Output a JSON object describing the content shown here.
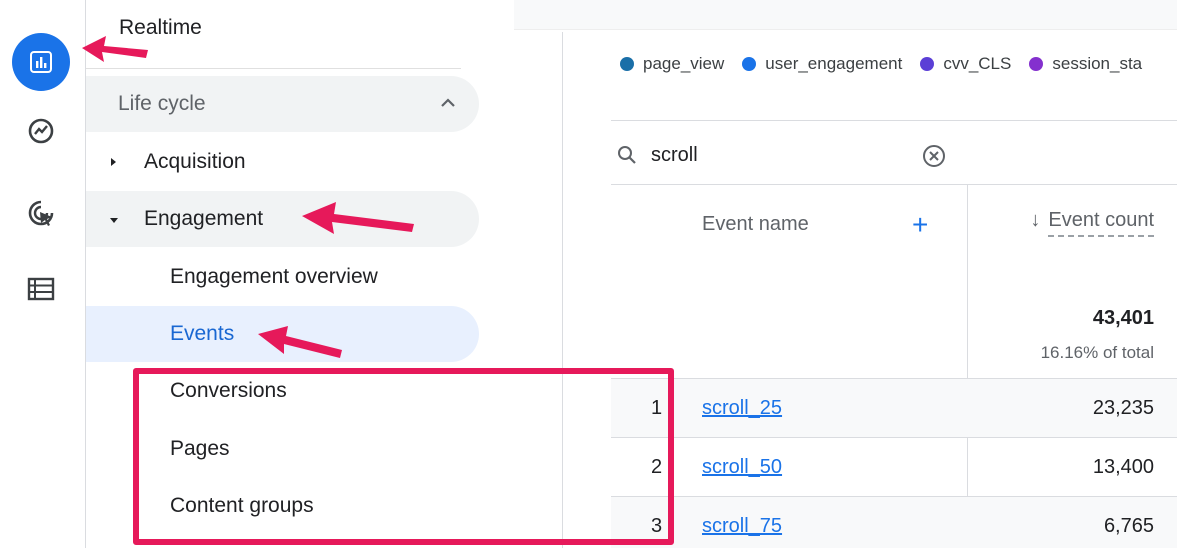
{
  "rail": {
    "icons": [
      "reports-icon",
      "explore-icon",
      "advertising-icon",
      "configure-icon"
    ]
  },
  "nav": {
    "realtime": "Realtime",
    "lifecycle": "Life cycle",
    "acquisition": "Acquisition",
    "engagement": "Engagement",
    "engagement_overview": "Engagement overview",
    "events": "Events",
    "conversions": "Conversions",
    "pages": "Pages",
    "content_groups": "Content groups"
  },
  "legend": [
    {
      "label": "page_view",
      "color": "#1a6fa8"
    },
    {
      "label": "user_engagement",
      "color": "#1a73e8"
    },
    {
      "label": "cvv_CLS",
      "color": "#5b3fd6"
    },
    {
      "label": "session_sta",
      "color": "#8430ce"
    }
  ],
  "table": {
    "search_value": "scroll",
    "col_event_name": "Event name",
    "add_label": "+",
    "sort_arrow": "↓",
    "col_event_count": "Event count",
    "total_value": "43,401",
    "total_pct": "16.16% of total",
    "rows": [
      {
        "index": "1",
        "name": "scroll_25",
        "count": "23,235"
      },
      {
        "index": "2",
        "name": "scroll_50",
        "count": "13,400"
      },
      {
        "index": "3",
        "name": "scroll_75",
        "count": "6,765"
      }
    ]
  },
  "colors": {
    "accent": "#1a73e8",
    "annotation": "#e6195a"
  }
}
